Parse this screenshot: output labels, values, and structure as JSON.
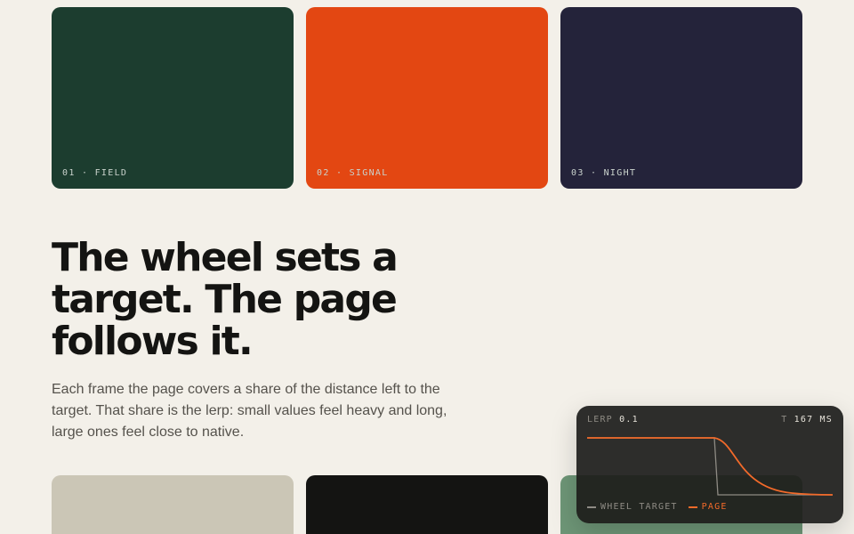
{
  "colors": {
    "background": "#f3f0e9",
    "field": "#1c3d2f",
    "signal": "#e34712",
    "night": "#24233a",
    "stone": "#cbc6b6",
    "ink": "#141412",
    "sage": "#6e9677",
    "wheel_target_line": "#8e8b84",
    "page_line": "#f26a2a"
  },
  "top_cards": [
    {
      "label": "01 · FIELD",
      "color_key": "field"
    },
    {
      "label": "02 · SIGNAL",
      "color_key": "signal"
    },
    {
      "label": "03 · NIGHT",
      "color_key": "night"
    }
  ],
  "bottom_cards": [
    {
      "color_key": "stone"
    },
    {
      "color_key": "ink"
    },
    {
      "color_key": "sage"
    }
  ],
  "headline": "The wheel sets a target. The page follows it.",
  "body": "Each frame the page covers a share of the distance left to the target. That share is the lerp: small values feel heavy and long, large ones feel close to native.",
  "panel": {
    "lerp_label": "LERP",
    "lerp_value": "0.1",
    "t_label": "T",
    "t_value": "167 MS",
    "legend": {
      "wheel_target": "WHEEL TARGET",
      "page": "PAGE"
    }
  }
}
